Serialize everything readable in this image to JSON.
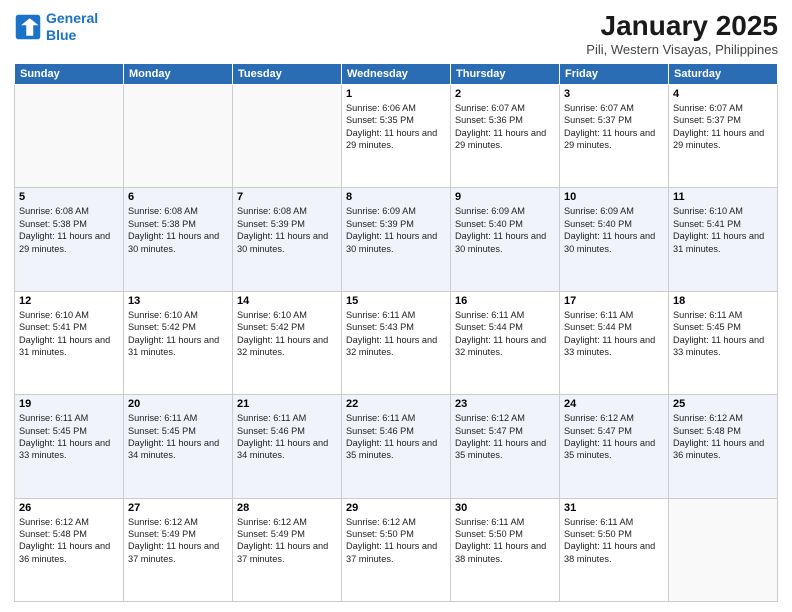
{
  "header": {
    "logo_line1": "General",
    "logo_line2": "Blue",
    "month": "January 2025",
    "location": "Pili, Western Visayas, Philippines"
  },
  "days_header": [
    "Sunday",
    "Monday",
    "Tuesday",
    "Wednesday",
    "Thursday",
    "Friday",
    "Saturday"
  ],
  "weeks": [
    [
      {
        "day": "",
        "sunrise": "",
        "sunset": "",
        "daylight": ""
      },
      {
        "day": "",
        "sunrise": "",
        "sunset": "",
        "daylight": ""
      },
      {
        "day": "",
        "sunrise": "",
        "sunset": "",
        "daylight": ""
      },
      {
        "day": "1",
        "sunrise": "Sunrise: 6:06 AM",
        "sunset": "Sunset: 5:35 PM",
        "daylight": "Daylight: 11 hours and 29 minutes."
      },
      {
        "day": "2",
        "sunrise": "Sunrise: 6:07 AM",
        "sunset": "Sunset: 5:36 PM",
        "daylight": "Daylight: 11 hours and 29 minutes."
      },
      {
        "day": "3",
        "sunrise": "Sunrise: 6:07 AM",
        "sunset": "Sunset: 5:37 PM",
        "daylight": "Daylight: 11 hours and 29 minutes."
      },
      {
        "day": "4",
        "sunrise": "Sunrise: 6:07 AM",
        "sunset": "Sunset: 5:37 PM",
        "daylight": "Daylight: 11 hours and 29 minutes."
      }
    ],
    [
      {
        "day": "5",
        "sunrise": "Sunrise: 6:08 AM",
        "sunset": "Sunset: 5:38 PM",
        "daylight": "Daylight: 11 hours and 29 minutes."
      },
      {
        "day": "6",
        "sunrise": "Sunrise: 6:08 AM",
        "sunset": "Sunset: 5:38 PM",
        "daylight": "Daylight: 11 hours and 30 minutes."
      },
      {
        "day": "7",
        "sunrise": "Sunrise: 6:08 AM",
        "sunset": "Sunset: 5:39 PM",
        "daylight": "Daylight: 11 hours and 30 minutes."
      },
      {
        "day": "8",
        "sunrise": "Sunrise: 6:09 AM",
        "sunset": "Sunset: 5:39 PM",
        "daylight": "Daylight: 11 hours and 30 minutes."
      },
      {
        "day": "9",
        "sunrise": "Sunrise: 6:09 AM",
        "sunset": "Sunset: 5:40 PM",
        "daylight": "Daylight: 11 hours and 30 minutes."
      },
      {
        "day": "10",
        "sunrise": "Sunrise: 6:09 AM",
        "sunset": "Sunset: 5:40 PM",
        "daylight": "Daylight: 11 hours and 30 minutes."
      },
      {
        "day": "11",
        "sunrise": "Sunrise: 6:10 AM",
        "sunset": "Sunset: 5:41 PM",
        "daylight": "Daylight: 11 hours and 31 minutes."
      }
    ],
    [
      {
        "day": "12",
        "sunrise": "Sunrise: 6:10 AM",
        "sunset": "Sunset: 5:41 PM",
        "daylight": "Daylight: 11 hours and 31 minutes."
      },
      {
        "day": "13",
        "sunrise": "Sunrise: 6:10 AM",
        "sunset": "Sunset: 5:42 PM",
        "daylight": "Daylight: 11 hours and 31 minutes."
      },
      {
        "day": "14",
        "sunrise": "Sunrise: 6:10 AM",
        "sunset": "Sunset: 5:42 PM",
        "daylight": "Daylight: 11 hours and 32 minutes."
      },
      {
        "day": "15",
        "sunrise": "Sunrise: 6:11 AM",
        "sunset": "Sunset: 5:43 PM",
        "daylight": "Daylight: 11 hours and 32 minutes."
      },
      {
        "day": "16",
        "sunrise": "Sunrise: 6:11 AM",
        "sunset": "Sunset: 5:44 PM",
        "daylight": "Daylight: 11 hours and 32 minutes."
      },
      {
        "day": "17",
        "sunrise": "Sunrise: 6:11 AM",
        "sunset": "Sunset: 5:44 PM",
        "daylight": "Daylight: 11 hours and 33 minutes."
      },
      {
        "day": "18",
        "sunrise": "Sunrise: 6:11 AM",
        "sunset": "Sunset: 5:45 PM",
        "daylight": "Daylight: 11 hours and 33 minutes."
      }
    ],
    [
      {
        "day": "19",
        "sunrise": "Sunrise: 6:11 AM",
        "sunset": "Sunset: 5:45 PM",
        "daylight": "Daylight: 11 hours and 33 minutes."
      },
      {
        "day": "20",
        "sunrise": "Sunrise: 6:11 AM",
        "sunset": "Sunset: 5:45 PM",
        "daylight": "Daylight: 11 hours and 34 minutes."
      },
      {
        "day": "21",
        "sunrise": "Sunrise: 6:11 AM",
        "sunset": "Sunset: 5:46 PM",
        "daylight": "Daylight: 11 hours and 34 minutes."
      },
      {
        "day": "22",
        "sunrise": "Sunrise: 6:11 AM",
        "sunset": "Sunset: 5:46 PM",
        "daylight": "Daylight: 11 hours and 35 minutes."
      },
      {
        "day": "23",
        "sunrise": "Sunrise: 6:12 AM",
        "sunset": "Sunset: 5:47 PM",
        "daylight": "Daylight: 11 hours and 35 minutes."
      },
      {
        "day": "24",
        "sunrise": "Sunrise: 6:12 AM",
        "sunset": "Sunset: 5:47 PM",
        "daylight": "Daylight: 11 hours and 35 minutes."
      },
      {
        "day": "25",
        "sunrise": "Sunrise: 6:12 AM",
        "sunset": "Sunset: 5:48 PM",
        "daylight": "Daylight: 11 hours and 36 minutes."
      }
    ],
    [
      {
        "day": "26",
        "sunrise": "Sunrise: 6:12 AM",
        "sunset": "Sunset: 5:48 PM",
        "daylight": "Daylight: 11 hours and 36 minutes."
      },
      {
        "day": "27",
        "sunrise": "Sunrise: 6:12 AM",
        "sunset": "Sunset: 5:49 PM",
        "daylight": "Daylight: 11 hours and 37 minutes."
      },
      {
        "day": "28",
        "sunrise": "Sunrise: 6:12 AM",
        "sunset": "Sunset: 5:49 PM",
        "daylight": "Daylight: 11 hours and 37 minutes."
      },
      {
        "day": "29",
        "sunrise": "Sunrise: 6:12 AM",
        "sunset": "Sunset: 5:50 PM",
        "daylight": "Daylight: 11 hours and 37 minutes."
      },
      {
        "day": "30",
        "sunrise": "Sunrise: 6:11 AM",
        "sunset": "Sunset: 5:50 PM",
        "daylight": "Daylight: 11 hours and 38 minutes."
      },
      {
        "day": "31",
        "sunrise": "Sunrise: 6:11 AM",
        "sunset": "Sunset: 5:50 PM",
        "daylight": "Daylight: 11 hours and 38 minutes."
      },
      {
        "day": "",
        "sunrise": "",
        "sunset": "",
        "daylight": ""
      }
    ]
  ]
}
